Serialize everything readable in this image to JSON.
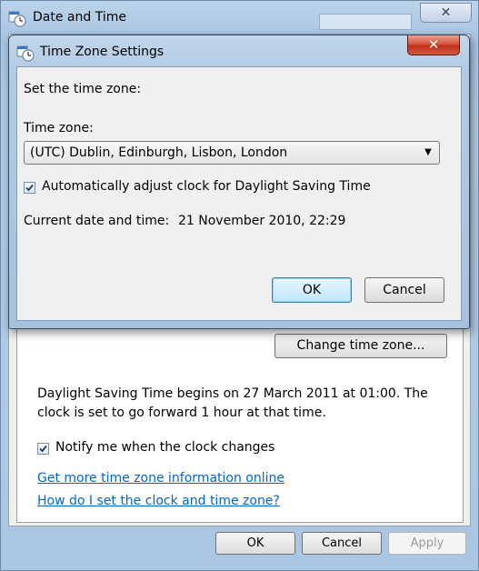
{
  "background_window": {
    "title": "Date and Time",
    "icon": "date-time-icon",
    "close_glyph": "✕",
    "change_timezone_button": "Change time zone...",
    "dst_info": "Daylight Saving Time begins on 27 March 2011 at 01:00. The clock is set to go forward 1 hour at that time.",
    "notify_checkbox": {
      "label": "Notify me when the clock changes",
      "checked": true
    },
    "links": [
      "Get more time zone information online",
      "How do I set the clock and time zone?"
    ],
    "buttons": {
      "ok": "OK",
      "cancel": "Cancel",
      "apply": "Apply"
    }
  },
  "dialog": {
    "title": "Time Zone Settings",
    "icon": "date-time-icon",
    "close_glyph": "✕",
    "heading": "Set the time zone:",
    "timezone_label": "Time zone:",
    "timezone_value": "(UTC) Dublin, Edinburgh, Lisbon, London",
    "dst_checkbox": {
      "label": "Automatically adjust clock for Daylight Saving Time",
      "checked": true
    },
    "current_label": "Current date and time:",
    "current_value": "21 November 2010, 22:29",
    "buttons": {
      "ok": "OK",
      "cancel": "Cancel"
    }
  },
  "colors": {
    "link": "#0066cc",
    "close_button_red": "#c2301a",
    "default_button_border": "#3c7fb1"
  }
}
